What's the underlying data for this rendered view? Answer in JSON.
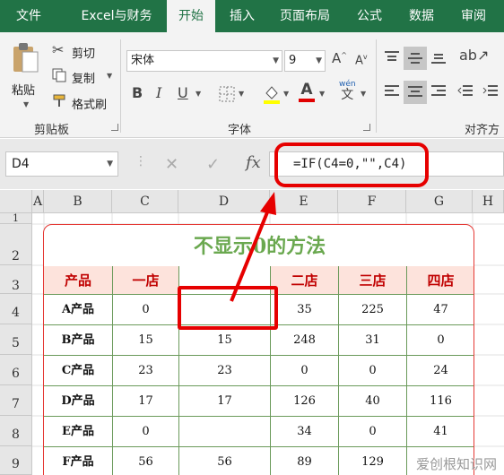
{
  "ribbon_tabs": [
    "文件",
    "Excel与财务",
    "开始",
    "插入",
    "页面布局",
    "公式",
    "数据",
    "审阅"
  ],
  "active_tab_index": 2,
  "clipboard": {
    "paste": "粘贴",
    "cut": "剪切",
    "copy": "复制",
    "format_painter": "格式刷",
    "group": "剪贴板"
  },
  "font": {
    "name": "宋体",
    "size": "9",
    "group": "字体",
    "wen": "wén",
    "wen_char": "文"
  },
  "alignment": {
    "group": "对齐方"
  },
  "formula_bar": {
    "name_box": "D4",
    "formula": "=IF(C4=0,\"\",C4)",
    "fx": "fx"
  },
  "columns": [
    "A",
    "B",
    "C",
    "D",
    "E",
    "F",
    "G",
    "H"
  ],
  "rows": [
    "1",
    "2",
    "3",
    "4",
    "5",
    "6",
    "7",
    "8",
    "9"
  ],
  "sheet": {
    "title": "不显示0的方法",
    "headers": [
      "产品",
      "一店",
      "",
      "二店",
      "三店",
      "四店"
    ],
    "data": [
      [
        "A产品",
        "0",
        "",
        "35",
        "225",
        "47"
      ],
      [
        "B产品",
        "15",
        "15",
        "248",
        "31",
        "0"
      ],
      [
        "C产品",
        "23",
        "23",
        "0",
        "0",
        "24"
      ],
      [
        "D产品",
        "17",
        "17",
        "126",
        "40",
        "116"
      ],
      [
        "E产品",
        "0",
        "",
        "34",
        "0",
        "41"
      ],
      [
        "F产品",
        "56",
        "56",
        "89",
        "129",
        ""
      ]
    ]
  },
  "watermark": "爱创根知识网",
  "colors": {
    "excel_green": "#217346",
    "title_green": "#6aa84f",
    "header_red": "#c00000",
    "highlight_red": "#e60000"
  }
}
